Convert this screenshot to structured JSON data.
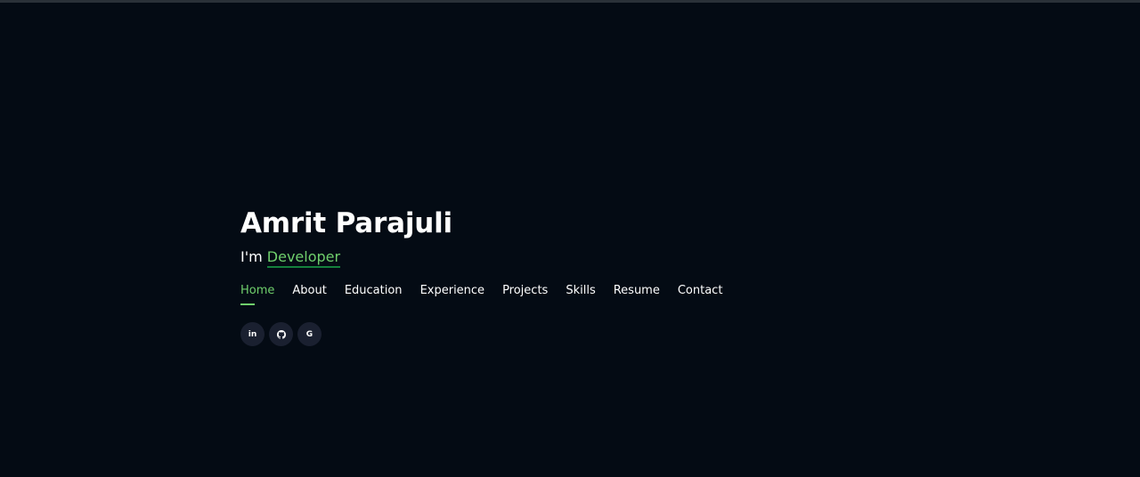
{
  "hero": {
    "name": "Amrit Parajuli",
    "prefix": "I'm ",
    "role": "Developer"
  },
  "nav": {
    "items": [
      {
        "label": "Home"
      },
      {
        "label": "About"
      },
      {
        "label": "Education"
      },
      {
        "label": "Experience"
      },
      {
        "label": "Projects"
      },
      {
        "label": "Skills"
      },
      {
        "label": "Resume"
      },
      {
        "label": "Contact"
      }
    ]
  },
  "social": {
    "items": [
      {
        "icon": "linkedin-icon",
        "glyph": "in"
      },
      {
        "icon": "github-icon"
      },
      {
        "icon": "google-icon",
        "glyph": "G"
      }
    ]
  },
  "colors": {
    "background": "#040b14",
    "accent": "#6fcf6c",
    "text": "#ffffff",
    "social_bg": "#1a2030"
  }
}
